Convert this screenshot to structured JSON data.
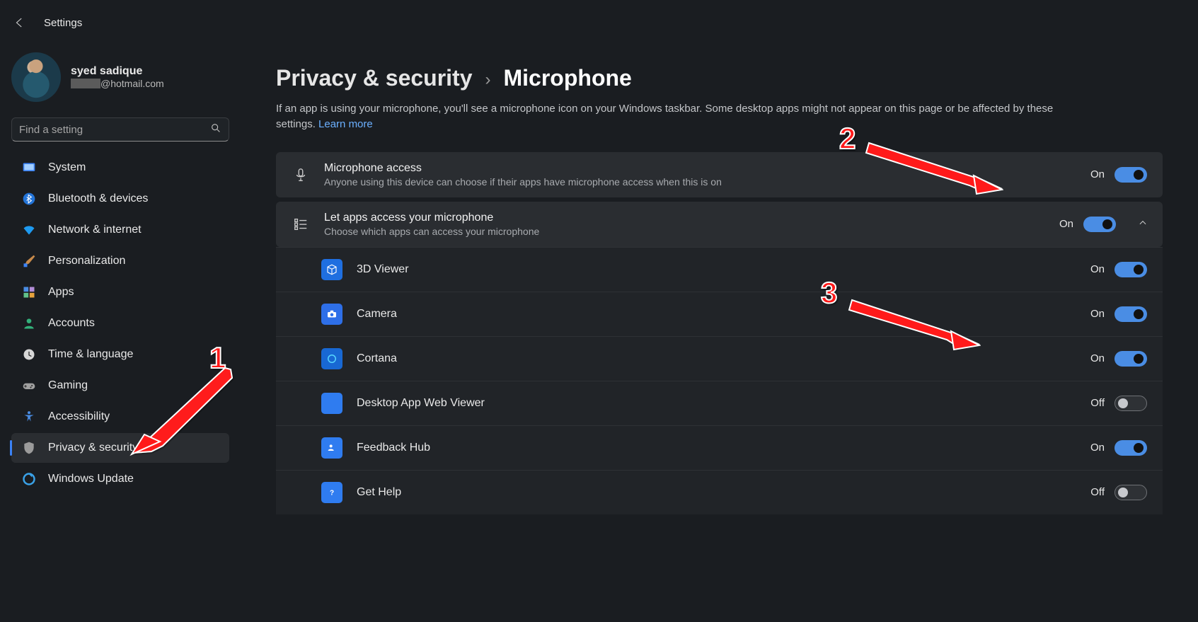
{
  "app": {
    "title": "Settings"
  },
  "user": {
    "name": "syed sadique",
    "email_suffix": "@hotmail.com"
  },
  "search": {
    "placeholder": "Find a setting"
  },
  "nav": {
    "items": [
      {
        "label": "System"
      },
      {
        "label": "Bluetooth & devices"
      },
      {
        "label": "Network & internet"
      },
      {
        "label": "Personalization"
      },
      {
        "label": "Apps"
      },
      {
        "label": "Accounts"
      },
      {
        "label": "Time & language"
      },
      {
        "label": "Gaming"
      },
      {
        "label": "Accessibility"
      },
      {
        "label": "Privacy & security"
      },
      {
        "label": "Windows Update"
      }
    ]
  },
  "breadcrumb": {
    "parent": "Privacy & security",
    "current": "Microphone"
  },
  "description": "If an app is using your microphone, you'll see a microphone icon on your Windows taskbar. Some desktop apps might not appear on this page or be affected by these settings.  ",
  "learn_more": "Learn more",
  "mic_access": {
    "title": "Microphone access",
    "sub": "Anyone using this device can choose if their apps have microphone access when this is on",
    "state": "On"
  },
  "let_apps": {
    "title": "Let apps access your microphone",
    "sub": "Choose which apps can access your microphone",
    "state": "On"
  },
  "apps": [
    {
      "name": "3D Viewer",
      "state": "On",
      "icon_bg": "#1f6fe0",
      "icon_fg": "#ffffff"
    },
    {
      "name": "Camera",
      "state": "On",
      "icon_bg": "#2e6fe8",
      "icon_fg": "#ffffff"
    },
    {
      "name": "Cortana",
      "state": "On",
      "icon_bg": "#1868d3",
      "icon_fg": "#56d7ff"
    },
    {
      "name": "Desktop App Web Viewer",
      "state": "Off",
      "icon_bg": "#2f7cf0",
      "icon_fg": "#ffffff"
    },
    {
      "name": "Feedback Hub",
      "state": "On",
      "icon_bg": "#2f7cf0",
      "icon_fg": "#ffffff"
    },
    {
      "name": "Get Help",
      "state": "Off",
      "icon_bg": "#2f7cf0",
      "icon_fg": "#ffffff"
    }
  ],
  "annotations": [
    {
      "label": "1"
    },
    {
      "label": "2"
    },
    {
      "label": "3"
    }
  ]
}
